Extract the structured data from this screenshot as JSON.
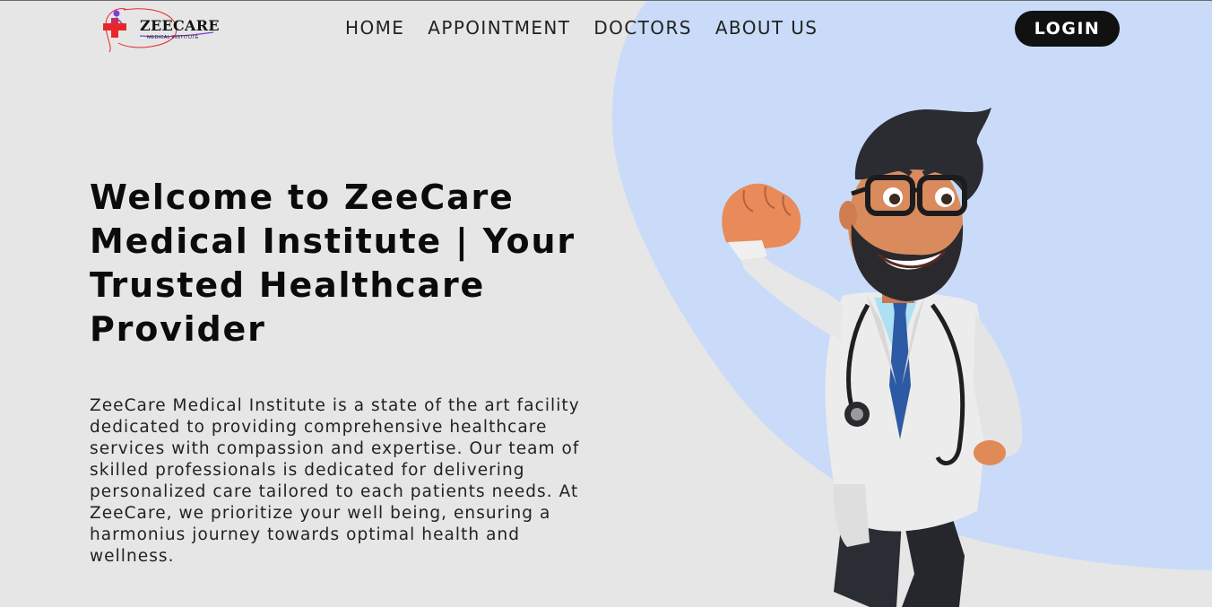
{
  "logo": {
    "name": "ZEECARE",
    "subtitle": "MEDICAL INSTITUTE"
  },
  "nav": {
    "links": [
      "HOME",
      "APPOINTMENT",
      "DOCTORS",
      "ABOUT US"
    ],
    "login_label": "LOGIN"
  },
  "hero": {
    "title": "Welcome to ZeeCare Medical Institute | Your Trusted Healthcare Provider",
    "description": "ZeeCare Medical Institute is a state of the art facility dedicated to providing comprehensive healthcare services with compassion and expertise. Our team of skilled professionals is dedicated for delivering personalized care tailored to each patients needs. At ZeeCare, we prioritize your well being, ensuring a harmonius journey towards optimal health and wellness."
  },
  "colors": {
    "background": "#e6e6e6",
    "blob": "#c9dbf8",
    "login_bg": "#111111",
    "logo_red": "#e8262a",
    "logo_purple": "#7b3ed6"
  },
  "icons": {
    "logo_mark": "medical-cross-icon",
    "hero_image": "doctor-illustration"
  }
}
